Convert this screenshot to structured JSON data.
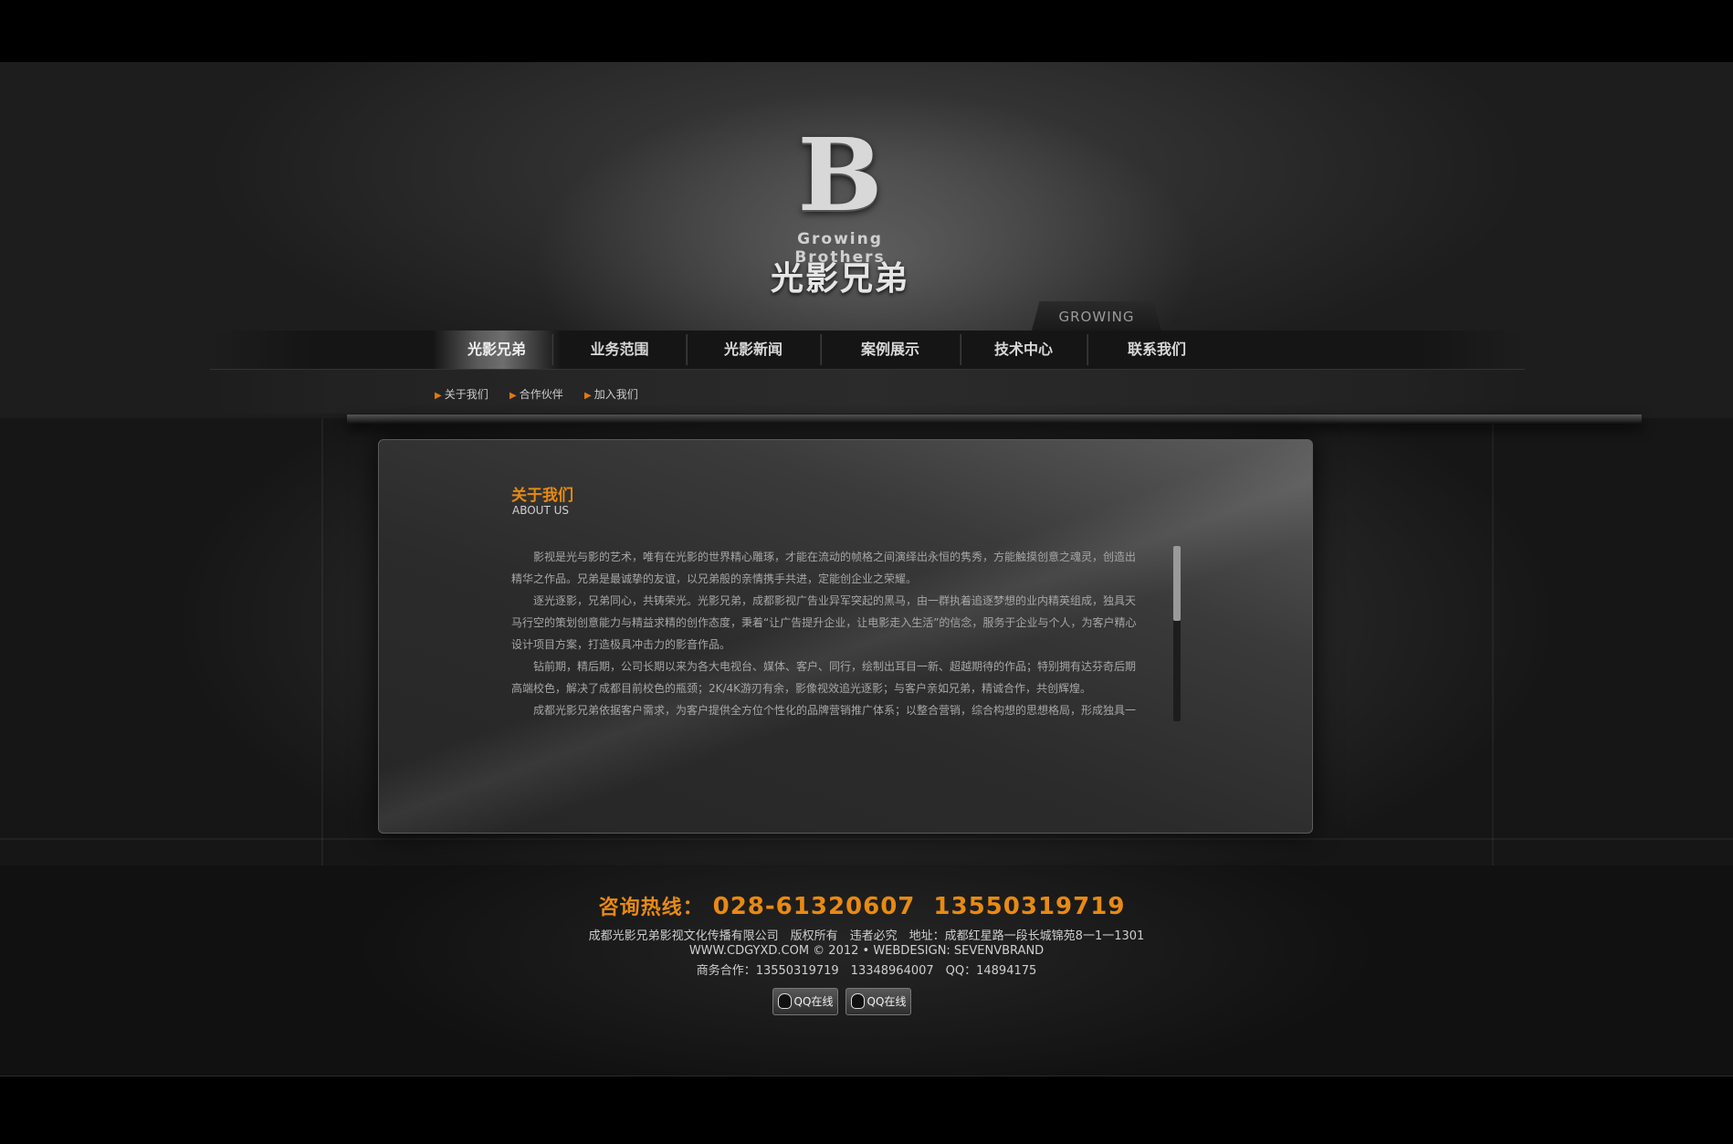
{
  "logo": {
    "letter": "B",
    "name_en": "Growing Brothers",
    "name_cn": "光影兄弟"
  },
  "header_tab": "GROWING",
  "nav": [
    {
      "label": "光影兄弟",
      "active": true
    },
    {
      "label": "业务范围",
      "active": false
    },
    {
      "label": "光影新闻",
      "active": false
    },
    {
      "label": "案例展示",
      "active": false
    },
    {
      "label": "技术中心",
      "active": false
    },
    {
      "label": "联系我们",
      "active": false
    }
  ],
  "subnav": [
    "关于我们",
    "合作伙伴",
    "加入我们"
  ],
  "content": {
    "title_cn": "关于我们",
    "title_en": "ABOUT US",
    "paragraphs": [
      "影视是光与影的艺术，唯有在光影的世界精心雕琢，才能在流动的帧格之间演绎出永恒的隽秀，方能触摸创意之魂灵，创造出精华之作品。兄弟是最诚挚的友谊，以兄弟般的亲情携手共进，定能创企业之荣耀。",
      "逐光逐影，兄弟同心，共铸荣光。光影兄弟，成都影视广告业异军突起的黑马，由一群执着追逐梦想的业内精英组成，独具天马行空的策划创意能力与精益求精的创作态度，秉着“让广告提升企业，让电影走入生活”的信念，服务于企业与个人，为客户精心设计项目方案，打造极具冲击力的影音作品。",
      "钻前期，精后期，公司长期以来为各大电视台、媒体、客户、同行，绘制出耳目一新、超越期待的作品；特别拥有达芬奇后期高端校色，解决了成都目前校色的瓶颈；2K/4K游刃有余，影像视效追光逐影；与客户亲如兄弟，精诚合作，共创辉煌。",
      "成都光影兄弟依据客户需求，为客户提供全方位个性化的品牌营销推广体系；以整合营销，综合构想的思想格局，形成独具一"
    ]
  },
  "footer": {
    "hotline_label": "咨询热线：",
    "hotline_1": "028-61320607",
    "hotline_2": "13550319719",
    "company_line": "成都光影兄弟影视文化传播有限公司　版权所有　违者必究　地址：成都红星路一段长城锦苑8一1一1301",
    "site_line": "WWW.CDGYXD.COM © 2012 • WEBDESIGN: SEVENVBRAND",
    "business_line": "商务合作：13550319719　13348964007　QQ：14894175",
    "qq_buttons": [
      "QQ在线",
      "QQ在线"
    ]
  },
  "colors": {
    "accent": "#e88a12",
    "background": "#000000",
    "panel": "#2e2e2e"
  }
}
